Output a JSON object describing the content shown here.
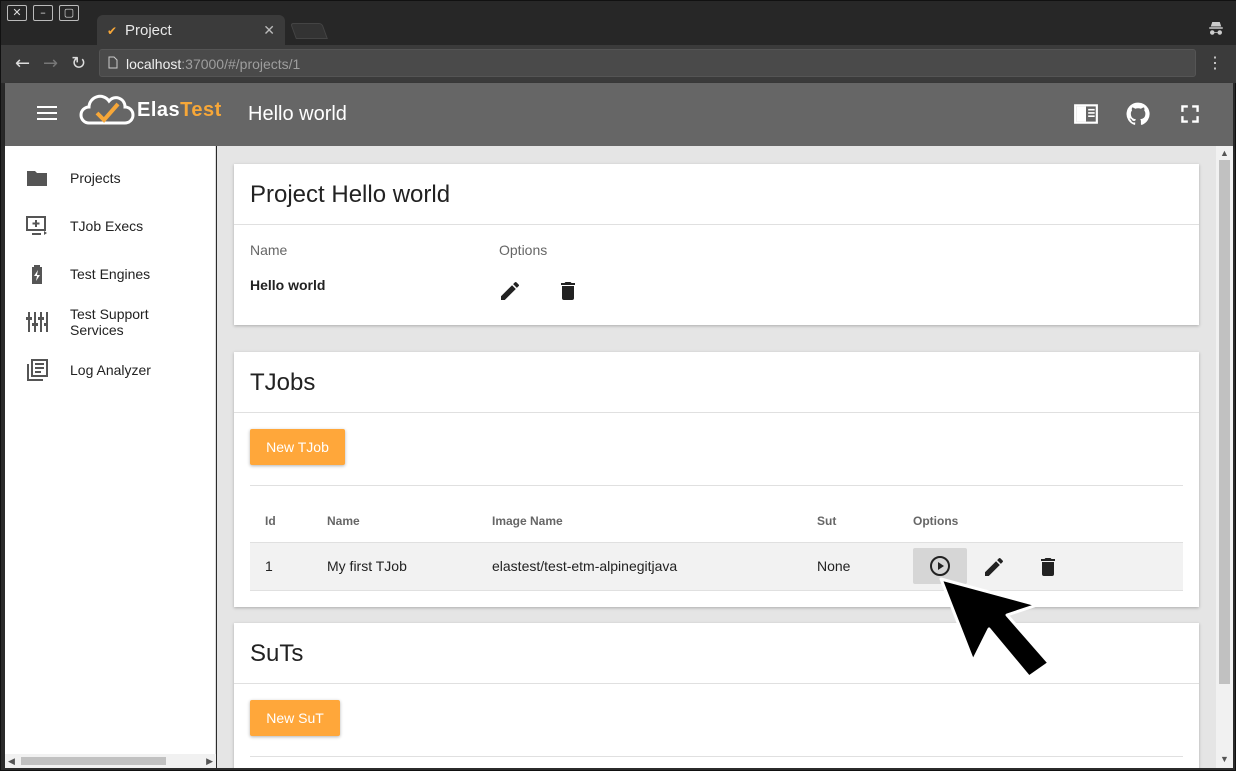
{
  "browser": {
    "tab_title": "Project",
    "url_host": "localhost",
    "url_rest": ":37000/#/projects/1"
  },
  "app": {
    "logo_main": "Elas",
    "logo_accent": "Test",
    "header_title": "Hello world"
  },
  "sidebar": {
    "items": [
      {
        "label": "Projects",
        "icon": "folder-icon"
      },
      {
        "label": "TJob Execs",
        "icon": "monitor-add-icon"
      },
      {
        "label": "Test Engines",
        "icon": "battery-bolt-icon"
      },
      {
        "label": "Test Support Services",
        "icon": "sliders-icon"
      },
      {
        "label": "Log Analyzer",
        "icon": "library-books-icon"
      }
    ]
  },
  "project_card": {
    "title": "Project Hello world",
    "col_name": "Name",
    "col_options": "Options",
    "name_value": "Hello world"
  },
  "tjobs_card": {
    "title": "TJobs",
    "new_button": "New TJob",
    "columns": [
      "Id",
      "Name",
      "Image Name",
      "Sut",
      "Options"
    ],
    "rows": [
      {
        "id": "1",
        "name": "My first TJob",
        "image": "elastest/test-etm-alpinegitjava",
        "sut": "None"
      }
    ]
  },
  "suts_card": {
    "title": "SuTs",
    "new_button": "New SuT"
  },
  "colors": {
    "accent": "#ffa73a",
    "header": "#666666"
  }
}
